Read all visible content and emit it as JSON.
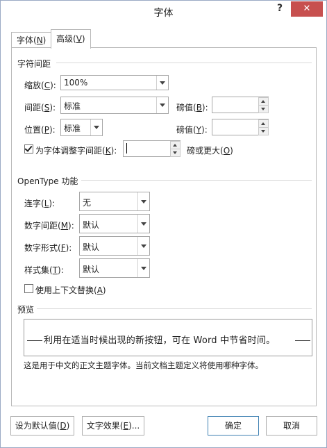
{
  "window": {
    "title": "字体",
    "help": "?",
    "close": "✕"
  },
  "tabs": [
    {
      "label": "字体(N)",
      "pre": "字体(",
      "key": "N",
      "post": ")"
    },
    {
      "label": "高级(V)",
      "pre": "高级(",
      "key": "V",
      "post": ")"
    }
  ],
  "spacing": {
    "header": "字符间距",
    "scale_label": {
      "pre": "缩放(",
      "key": "C",
      "post": "):"
    },
    "scale_value": "100%",
    "spacing_label": {
      "pre": "间距(",
      "key": "S",
      "post": "):"
    },
    "spacing_value": "标准",
    "spacing_by_label": {
      "pre": "磅值(",
      "key": "B",
      "post": "):"
    },
    "position_label": {
      "pre": "位置(",
      "key": "P",
      "post": "):"
    },
    "position_value": "标准",
    "position_by_label": {
      "pre": "磅值(",
      "key": "Y",
      "post": "):"
    },
    "kerning_label": {
      "pre": "为字体调整字间距(",
      "key": "K",
      "post": "):"
    },
    "kerning_checked": true,
    "kerning_suffix": {
      "pre": "磅或更大(",
      "key": "O",
      "post": ")"
    }
  },
  "opentype": {
    "header": "OpenType 功能",
    "ligatures_label": {
      "pre": "连字(",
      "key": "L",
      "post": "):"
    },
    "ligatures_value": "无",
    "number_spacing_label": {
      "pre": "数字间距(",
      "key": "M",
      "post": "):"
    },
    "number_spacing_value": "默认",
    "number_forms_label": {
      "pre": "数字形式(",
      "key": "F",
      "post": "):"
    },
    "number_forms_value": "默认",
    "stylistic_sets_label": {
      "pre": "样式集(",
      "key": "T",
      "post": "):"
    },
    "stylistic_sets_value": "默认",
    "contextual_label": {
      "pre": "使用上下文替换(",
      "key": "A",
      "post": ")"
    },
    "contextual_checked": false
  },
  "preview": {
    "header": "预览",
    "sample": "利用在适当时候出现的新按钮，可在 Word 中节省时间。",
    "note": "这是用于中文的正文主题字体。当前文档主题定义将使用哪种字体。"
  },
  "buttons": {
    "set_default": {
      "pre": "设为默认值(",
      "key": "D",
      "post": ")"
    },
    "text_effects": {
      "pre": "文字效果(",
      "key": "E",
      "post": ")..."
    },
    "ok": "确定",
    "cancel": "取消"
  }
}
